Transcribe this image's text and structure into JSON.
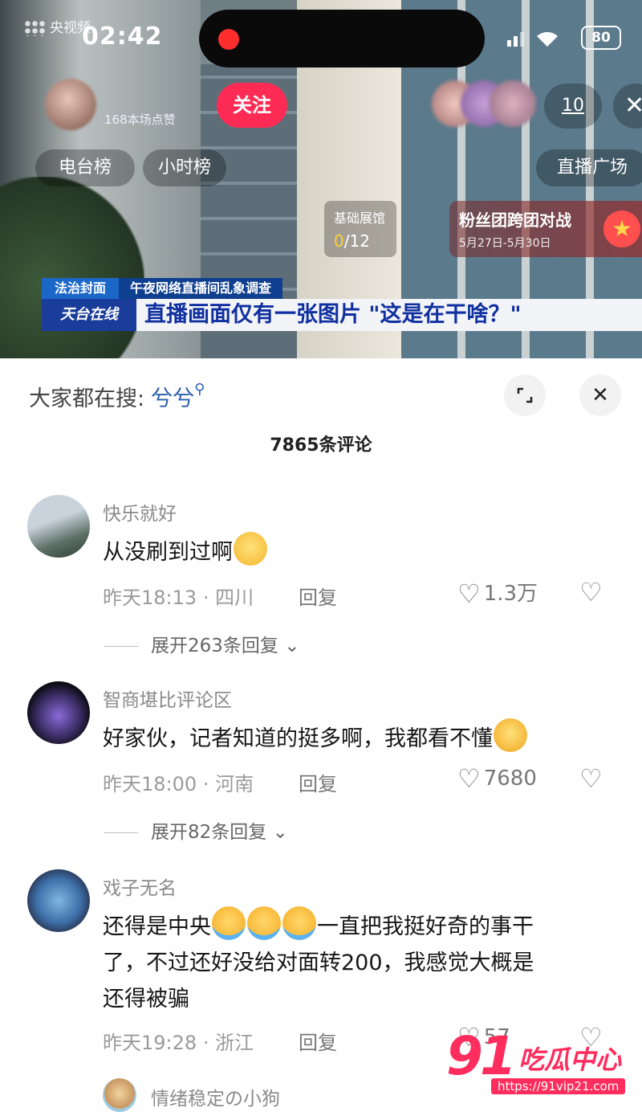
{
  "status_bar": {
    "time": "02:42",
    "battery": "80",
    "cctv_label": "央视频"
  },
  "live": {
    "viewers": "168本场点赞",
    "follow_label": "关注",
    "online_count": "10",
    "chips": [
      "电台榜",
      "小时榜"
    ],
    "plaza_label": "直播广场",
    "task": {
      "title": "基础展馆",
      "progress_done": "0",
      "progress_total": "/12"
    },
    "fan_battle": {
      "title": "粉丝团跨团对战",
      "dates": "5月27日-5月30日"
    }
  },
  "news_overlay": {
    "tag1": "法治封面",
    "tag2": "午夜网络直播间乱象调查",
    "logo": "天台在线",
    "headline": "直播画面仅有一张图片 \"这是在干啥？\""
  },
  "comments_sheet": {
    "search_prefix": "大家都在搜:",
    "search_keyword": "兮兮",
    "count_title": "7865条评论",
    "comments": [
      {
        "name": "快乐就好",
        "text": "从没刷到过啊",
        "time": "昨天18:13",
        "sep": "·",
        "region": "四川",
        "reply_label": "回复",
        "likes": "1.3万",
        "expand": "展开263条回复"
      },
      {
        "name": "智商堪比评论区",
        "text": "好家伙，记者知道的挺多啊，我都看不懂",
        "time": "昨天18:00",
        "sep": "·",
        "region": "河南",
        "reply_label": "回复",
        "likes": "7680",
        "expand": "展开82条回复"
      },
      {
        "name": "戏子无名",
        "text_a": "还得是中央",
        "text_b": "一直把我挺好奇的事干",
        "text_c": "了，不过还好没给对面转200，我感觉大概是",
        "text_d": "还得被骗",
        "time": "昨天19:28",
        "sep": "·",
        "region": "浙江",
        "reply_label": "回复",
        "likes": "57"
      },
      {
        "name": "情绪稳定の小狗"
      }
    ]
  },
  "watermark": {
    "number": "91",
    "text": "吃瓜中心",
    "url": "https://91vip21.com"
  },
  "colors": {
    "accent": "#fe2c55",
    "news_blue": "#1b67c8",
    "keyword": "#2c5fa8"
  }
}
